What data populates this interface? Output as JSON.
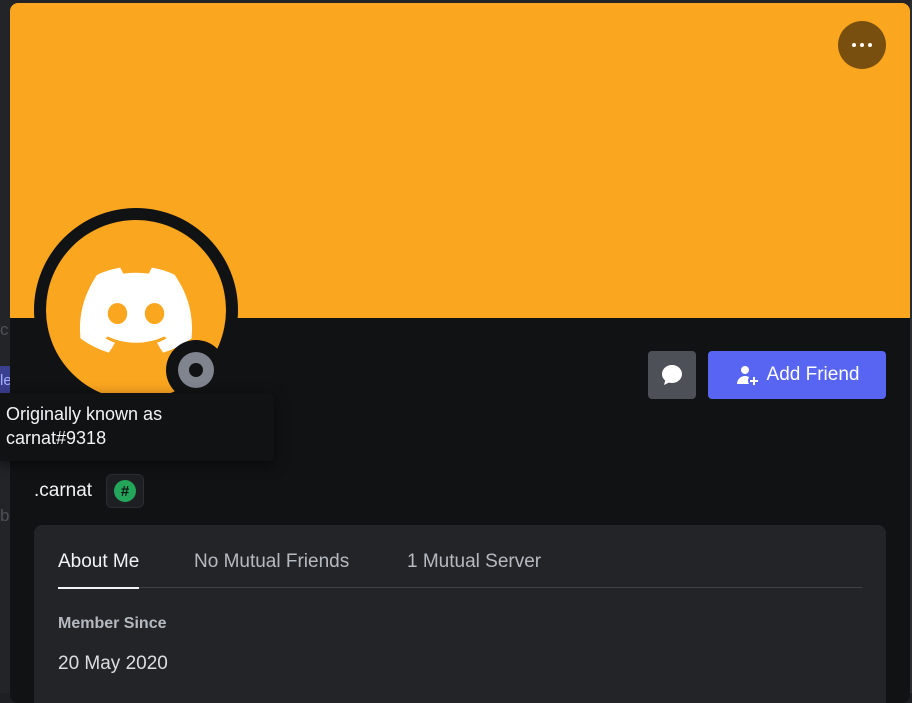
{
  "backdrop": {
    "letters": [
      "c",
      "le",
      "b"
    ]
  },
  "profile": {
    "banner_color": "#fba61f",
    "avatar_color": "#fba61f",
    "avatar_icon": "discord-logo-icon",
    "status": "offline",
    "more_icon": "more-horizontal-icon",
    "message_icon": "chat-bubble-icon",
    "add_friend_label": "Add Friend",
    "add_friend_icon": "person-add-icon",
    "accent_color": "#5865f2",
    "username": ".carnat",
    "badge_icon": "hashtag-badge-icon"
  },
  "tooltip": {
    "line1": "Originally known as",
    "line2": "carnat#9318"
  },
  "tabs": [
    {
      "label": "About Me",
      "active": true
    },
    {
      "label": "No Mutual Friends",
      "active": false
    },
    {
      "label": "1 Mutual Server",
      "active": false
    }
  ],
  "about": {
    "member_since_title": "Member Since",
    "member_since_value": "20 May 2020"
  }
}
